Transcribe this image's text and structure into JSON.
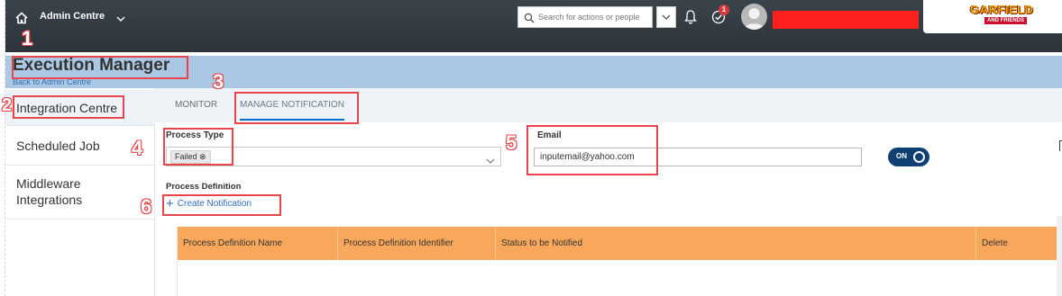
{
  "header": {
    "app_title": "Admin Centre",
    "search_placeholder": "Search for actions or people",
    "notification_count": "1",
    "logo_text": "GARFIELD",
    "logo_sub": "AND FRIENDS"
  },
  "page": {
    "title": "Execution Manager",
    "back_link": "Back to Admin Centre"
  },
  "sidebar": {
    "items": [
      {
        "label": "Integration Centre",
        "active": true
      },
      {
        "label": "Scheduled Job",
        "active": false
      },
      {
        "label": "Middleware Integrations",
        "active": false
      }
    ]
  },
  "tabs": [
    {
      "label": "MONITOR",
      "selected": false
    },
    {
      "label": "MANAGE NOTIFICATION",
      "selected": true
    }
  ],
  "form": {
    "process_type_label": "Process Type",
    "process_type_token": "Failed",
    "email_label": "Email",
    "email_value": "inputemail@yahoo.com",
    "toggle_label": "ON",
    "process_definition_label": "Process Definition",
    "create_label": "Create Notification"
  },
  "table": {
    "columns": [
      "Process Definition Name",
      "Process Definition Identifier",
      "Status to be Notified",
      "Delete"
    ]
  },
  "annotations": [
    "1",
    "2",
    "3",
    "4",
    "5",
    "6"
  ],
  "colors": {
    "shell_header": "#2c333a",
    "band": "#aac8e4",
    "table_header": "#f9a85b",
    "toggle": "#0f3f73",
    "annotation": "#e8444a",
    "link": "#2f6db5"
  }
}
